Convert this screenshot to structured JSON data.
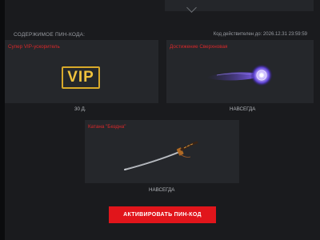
{
  "header": {
    "contents_label": "СОДЕРЖИМОЕ ПИН-КОДА:",
    "validity_label": "Код действителен до: 2026.12.31 23:59:59"
  },
  "items": [
    {
      "title": "Супер VIP-ускоритель",
      "duration": "30 Д.",
      "icon": "vip-badge-icon",
      "badge_text": "VIP"
    },
    {
      "title": "Достижение Сверхновая",
      "duration": "НАВСЕГДА",
      "icon": "supernova-achievement-icon"
    },
    {
      "title": "Катана \"Бездна\"",
      "duration": "НАВСЕГДА",
      "icon": "katana-icon"
    }
  ],
  "action": {
    "activate_label": "АКТИВИРОВАТЬ ПИН-КОД"
  },
  "colors": {
    "accent_red": "#e1151b",
    "title_red": "#d8282a",
    "vip_gold": "#f0c23d",
    "card_bg": "#25272b",
    "panel_bg": "#1a1b1e"
  }
}
